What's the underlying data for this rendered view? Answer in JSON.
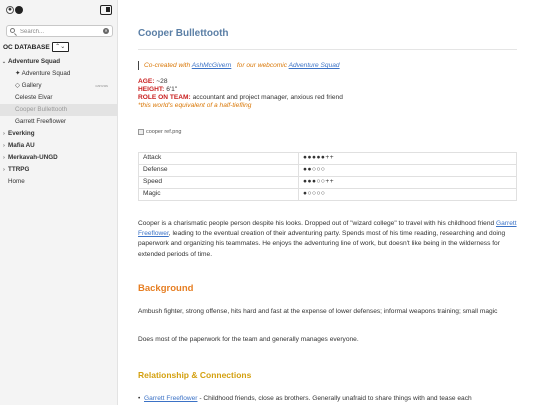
{
  "sidebar": {
    "search_placeholder": "Search...",
    "database_title": "OC DATABASE",
    "tree": [
      {
        "label": "Adventure Squad",
        "bold": true,
        "caret": "⌄",
        "level": 0
      },
      {
        "label": "✦ Adventure Squad",
        "bold": false,
        "level": 1
      },
      {
        "label": "◇ Gallery",
        "bold": false,
        "level": 1,
        "badge": "canvas"
      },
      {
        "label": "Celeste Elvar",
        "bold": false,
        "level": 1
      },
      {
        "label": "Cooper Bullettooth",
        "bold": false,
        "level": 1,
        "active": true
      },
      {
        "label": "Garrett Freeflower",
        "bold": false,
        "level": 1
      },
      {
        "label": "Everking",
        "bold": true,
        "caret": "›",
        "level": 0
      },
      {
        "label": "Mafia AU",
        "bold": true,
        "caret": "›",
        "level": 0
      },
      {
        "label": "Merkavah-UNGD",
        "bold": true,
        "caret": "›",
        "level": 0
      },
      {
        "label": "TTRPG",
        "bold": true,
        "caret": "›",
        "level": 0
      },
      {
        "label": "Home",
        "bold": false,
        "level": 0
      }
    ]
  },
  "page": {
    "title": "Cooper Bullettooth",
    "credit": {
      "prefix": "Co-created with ",
      "author": "AshMcGivern",
      "middle": "   for our webcomic ",
      "comic": "Adventure Squad"
    },
    "stats": {
      "age_label": "AGE:",
      "age_value": " ~28",
      "height_label": "HEIGHT:",
      "height_value": " 6'1\"",
      "role_label": "ROLE ON TEAM:",
      "role_value": " accountant and project manager, anxious red friend",
      "tiefling": "*this world's equivalent of a half-tiefling"
    },
    "image_alt": "cooper ref.png",
    "stat_table": [
      {
        "name": "Attack",
        "value": "●●●●●++"
      },
      {
        "name": "Defense",
        "value": "●●○○○"
      },
      {
        "name": "Speed",
        "value": "●●●○○++"
      },
      {
        "name": "Magic",
        "value": "●○○○○"
      }
    ],
    "intro": {
      "part1": "Cooper is a charismatic people person despite his looks. Dropped out of \"wizard college\" to travel with his childhood friend ",
      "link": "Garrett Freeflower",
      "part2": ", leading to the eventual creation of their adventuring party. Spends most of his time reading, researching and doing paperwork and organizing his teammates. He enjoys the adventuring line of work, but doesn't like being in the wilderness for extended periods of time."
    },
    "background_heading": "Background",
    "background_p1": "Ambush fighter, strong offense, hits hard and fast at the expense of lower defenses; informal weapons training; small magic",
    "background_p2": "Does most of the paperwork for the team and generally manages everyone.",
    "relationships_heading": "Relationship & Connections",
    "rel_link": "Garrett Freeflower",
    "rel_text": " - Childhood friends, close as brothers. Generally unafraid to share things with and tease each"
  },
  "colors": {
    "title": "#5b7fa6",
    "credit": "#d97706",
    "stat_label": "#c81e1e",
    "background_heading": "#e67e22",
    "relationships_heading": "#d4a010",
    "link": "#3b72c6"
  },
  "icons": [
    "sun-icon",
    "moon-icon",
    "sidebar-toggle-icon",
    "search-icon",
    "clear-icon",
    "collapse-icon",
    "broken-image-icon"
  ]
}
